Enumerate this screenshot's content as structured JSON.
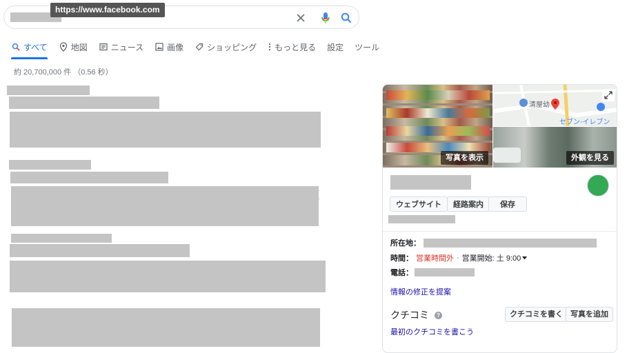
{
  "tooltip": {
    "url": "https://www.facebook.com"
  },
  "search": {
    "clear_icon": "close-icon",
    "mic_icon": "microphone-icon",
    "search_icon": "search-icon"
  },
  "tabs": [
    {
      "label": "すべて",
      "icon": "search-icon",
      "active": true
    },
    {
      "label": "地図",
      "icon": "map-pin-icon"
    },
    {
      "label": "ニュース",
      "icon": "news-icon"
    },
    {
      "label": "画像",
      "icon": "image-icon"
    },
    {
      "label": "ショッピング",
      "icon": "tag-icon"
    },
    {
      "label": "もっと見る",
      "icon": "more-vert-icon"
    },
    {
      "label": "設定"
    },
    {
      "label": "ツール"
    }
  ],
  "results_stats": "約 20,700,000 件 （0.56 秒）",
  "knowledge_panel": {
    "photos": {
      "view_photos": "写真を表示",
      "view_exterior": "外観を見る"
    },
    "map": {
      "place1": "清屋幼",
      "place2": "セブン-イレブン"
    },
    "buttons": {
      "website": "ウェブサイト",
      "directions": "経路案内",
      "save": "保存"
    },
    "address_label": "所在地：",
    "hours_label": "時間：",
    "hours_status": "営業時間外",
    "hours_separator": "·",
    "hours_open": "営業開始: 土 9:00",
    "phone_label": "電話：",
    "suggest_edit": "情報の修正を提案",
    "reviews_title": "クチコミ",
    "write_review": "クチコミを書く",
    "add_photo": "写真を追加",
    "first_review": "最初のクチコミを書こう"
  },
  "colors": {
    "accent": "#1a73e8",
    "link": "#1a0dab",
    "closed": "#d93025",
    "redacted": "#c4c4c4"
  }
}
